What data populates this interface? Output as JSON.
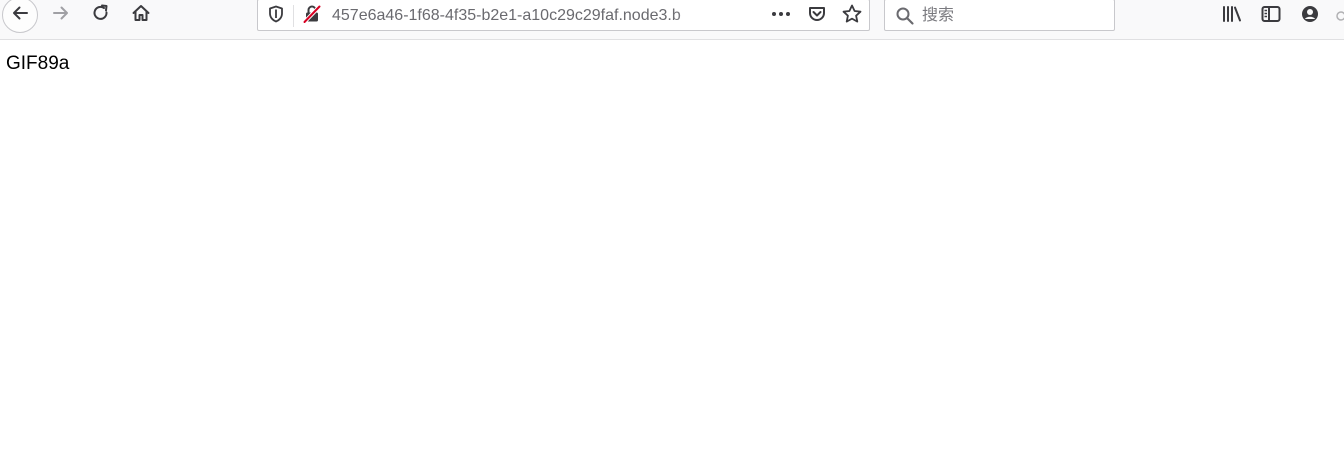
{
  "toolbar": {
    "url": "457e6a46-1f68-4f35-b2e1-a10c29c29faf.node3.b",
    "search_placeholder": "搜索",
    "icons": {
      "back": "back-arrow-icon",
      "forward": "forward-arrow-icon",
      "reload": "reload-icon",
      "home": "home-icon",
      "tracking_protection": "shield-icon",
      "insecure_connection": "insecure-lock-icon",
      "page_actions": "more-horizontal-icon",
      "pocket": "pocket-icon",
      "bookmark": "star-icon",
      "search": "search-icon",
      "library": "library-icon",
      "sidebars": "sidebar-icon",
      "account": "account-icon"
    },
    "colors": {
      "toolbar_bg": "#f9f9fa",
      "insecure_red": "#d70022",
      "icon_gray": "#3b3b3f"
    }
  },
  "page": {
    "body_text": "GIF89a"
  }
}
